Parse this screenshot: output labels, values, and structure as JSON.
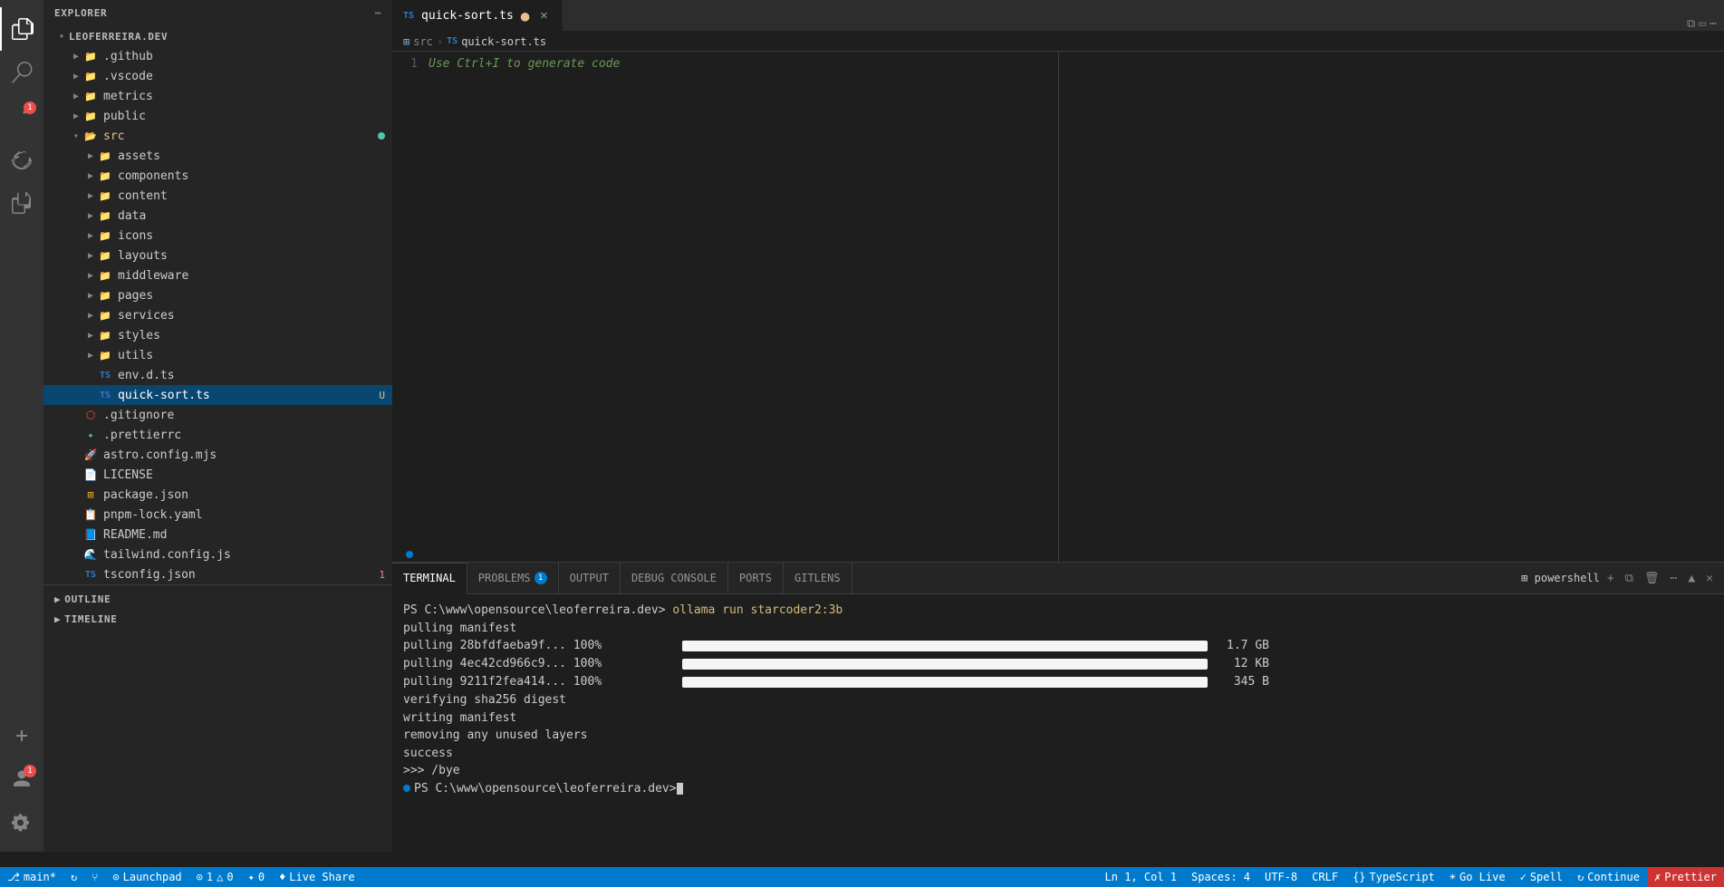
{
  "activityBar": {
    "items": [
      {
        "name": "explorer",
        "icon": "files",
        "active": true
      },
      {
        "name": "search",
        "icon": "search"
      },
      {
        "name": "source-control",
        "icon": "source-control",
        "badge": "1"
      },
      {
        "name": "run-debug",
        "icon": "debug"
      },
      {
        "name": "extensions",
        "icon": "extensions"
      },
      {
        "name": "remote-explorer",
        "icon": "remote"
      },
      {
        "name": "copilot",
        "icon": "copilot"
      }
    ],
    "bottomItems": [
      {
        "name": "accounts",
        "icon": "account",
        "badge": "1"
      },
      {
        "name": "settings",
        "icon": "settings"
      }
    ]
  },
  "sidebar": {
    "title": "Explorer",
    "rootFolder": "LEOFERREIRA.DEV",
    "tree": [
      {
        "id": "github",
        "label": ".github",
        "type": "folder",
        "indent": 1,
        "collapsed": true
      },
      {
        "id": "vscode",
        "label": ".vscode",
        "type": "folder",
        "indent": 1,
        "collapsed": true
      },
      {
        "id": "metrics",
        "label": "metrics",
        "type": "folder",
        "indent": 1,
        "collapsed": true
      },
      {
        "id": "public",
        "label": "public",
        "type": "folder",
        "indent": 1,
        "collapsed": true
      },
      {
        "id": "src",
        "label": "src",
        "type": "folder",
        "indent": 1,
        "collapsed": false,
        "modified": true
      },
      {
        "id": "assets",
        "label": "assets",
        "type": "folder",
        "indent": 2,
        "collapsed": true
      },
      {
        "id": "components",
        "label": "components",
        "type": "folder",
        "indent": 2,
        "collapsed": true
      },
      {
        "id": "content",
        "label": "content",
        "type": "folder",
        "indent": 2,
        "collapsed": true
      },
      {
        "id": "data",
        "label": "data",
        "type": "folder",
        "indent": 2,
        "collapsed": true
      },
      {
        "id": "icons",
        "label": "icons",
        "type": "folder",
        "indent": 2,
        "collapsed": true
      },
      {
        "id": "layouts",
        "label": "layouts",
        "type": "folder",
        "indent": 2,
        "collapsed": true
      },
      {
        "id": "middleware",
        "label": "middleware",
        "type": "folder",
        "indent": 2,
        "collapsed": true
      },
      {
        "id": "pages",
        "label": "pages",
        "type": "folder",
        "indent": 2,
        "collapsed": true
      },
      {
        "id": "services",
        "label": "services",
        "type": "folder",
        "indent": 2,
        "collapsed": true
      },
      {
        "id": "styles",
        "label": "styles",
        "type": "folder",
        "indent": 2,
        "collapsed": true
      },
      {
        "id": "utils",
        "label": "utils",
        "type": "folder",
        "indent": 2,
        "collapsed": true
      },
      {
        "id": "env",
        "label": "env.d.ts",
        "type": "ts",
        "indent": 2
      },
      {
        "id": "quick-sort",
        "label": "quick-sort.ts",
        "type": "ts",
        "indent": 2,
        "active": true,
        "badge": "U",
        "badgeColor": "yellow"
      },
      {
        "id": "gitignore",
        "label": ".gitignore",
        "type": "gitignore",
        "indent": 1
      },
      {
        "id": "prettierrc",
        "label": ".prettierrc",
        "type": "prettier",
        "indent": 1
      },
      {
        "id": "astro-config",
        "label": "astro.config.mjs",
        "type": "astro",
        "indent": 1
      },
      {
        "id": "license",
        "label": "LICENSE",
        "type": "license",
        "indent": 1
      },
      {
        "id": "package-json",
        "label": "package.json",
        "type": "json",
        "indent": 1
      },
      {
        "id": "pnpm-lock",
        "label": "pnpm-lock.yaml",
        "type": "yaml",
        "indent": 1
      },
      {
        "id": "readme",
        "label": "README.md",
        "type": "readme",
        "indent": 1
      },
      {
        "id": "tailwind",
        "label": "tailwind.config.js",
        "type": "tailwind",
        "indent": 1
      },
      {
        "id": "tsconfig",
        "label": "tsconfig.json",
        "type": "json",
        "indent": 1,
        "badge": "1",
        "badgeColor": "red"
      }
    ],
    "outline": {
      "label": "OUTLINE",
      "collapsed": true
    },
    "timeline": {
      "label": "TIMELINE",
      "collapsed": true
    }
  },
  "tabs": [
    {
      "label": "quick-sort.ts",
      "modified": true,
      "active": true,
      "icon": "ts"
    }
  ],
  "breadcrumb": {
    "parts": [
      "src",
      "quick-sort.ts"
    ]
  },
  "editor": {
    "lines": [
      {
        "number": 1,
        "code": "Use Ctrl+I to generate code"
      }
    ]
  },
  "terminal": {
    "tabs": [
      {
        "label": "TERMINAL",
        "active": true
      },
      {
        "label": "PROBLEMS",
        "badge": "1"
      },
      {
        "label": "OUTPUT"
      },
      {
        "label": "DEBUG CONSOLE"
      },
      {
        "label": "PORTS"
      },
      {
        "label": "GITLENS"
      }
    ],
    "shellName": "powershell",
    "lines": [
      {
        "type": "prompt",
        "text": "PS C:\\www\\opensource\\leoferreira.dev> ollama run starcoder2:3b"
      },
      {
        "type": "output",
        "text": "pulling manifest"
      },
      {
        "type": "progress",
        "label": "pulling 28bfdfaeba9f... 100%",
        "percent": 100,
        "size": "1.7 GB"
      },
      {
        "type": "progress",
        "label": "pulling 4ec42cd966c9... 100%",
        "percent": 100,
        "size": "12 KB"
      },
      {
        "type": "progress",
        "label": "pulling 9211f2fea414... 100%",
        "percent": 100,
        "size": "345 B"
      },
      {
        "type": "output",
        "text": "verifying sha256 digest"
      },
      {
        "type": "output",
        "text": "writing manifest"
      },
      {
        "type": "output",
        "text": "removing any unused layers"
      },
      {
        "type": "success",
        "text": "success"
      },
      {
        "type": "output",
        "text": ">>> /bye"
      },
      {
        "type": "prompt-end",
        "text": "PS C:\\www\\opensource\\leoferreira.dev> "
      }
    ]
  },
  "statusBar": {
    "left": [
      {
        "label": "⚡ main*",
        "icon": "branch"
      },
      {
        "label": "↻"
      },
      {
        "label": "⑂"
      },
      {
        "label": "♻ Launchpad"
      },
      {
        "label": "⊙ 1 △ 0"
      },
      {
        "label": "✦ 0"
      },
      {
        "label": "♦ Live Share"
      }
    ],
    "right": [
      {
        "label": "Ln 1, Col 1"
      },
      {
        "label": "Spaces: 4"
      },
      {
        "label": "UTF-8"
      },
      {
        "label": "CRLF"
      },
      {
        "label": "{} TypeScript"
      },
      {
        "label": "☀ Go Live"
      },
      {
        "label": "✓ Spell"
      },
      {
        "label": "↻ Continue"
      },
      {
        "label": "✗ Prettier",
        "style": "error"
      }
    ]
  }
}
